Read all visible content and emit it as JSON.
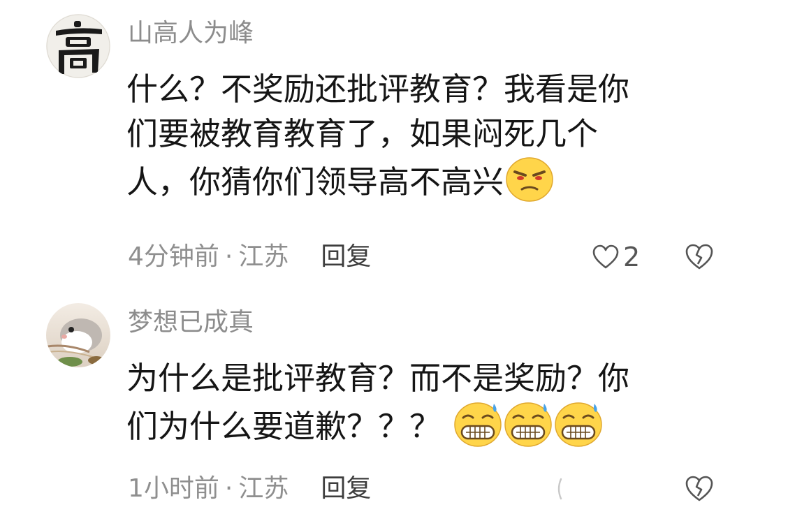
{
  "comments": [
    {
      "username": "山高人为峰",
      "avatar_icon": "calligraphy-avatar-gao",
      "lines": [
        "什么？不奖励还批评教育？我看是你",
        "们要被教育教育了，如果闷死几个",
        "人，你猜你们领导高不高兴"
      ],
      "emoji": "grimace-emoji",
      "time": "4分钟前",
      "separator": "·",
      "location": "江苏",
      "reply_label": "回复",
      "like_count": "2"
    },
    {
      "username": "梦想已成真",
      "avatar_icon": "hamster-photo-avatar",
      "lines": [
        "为什么是批评教育？而不是奖励？你",
        "们为什么要道歉？？？"
      ],
      "emoji": "cold-sweat-grin-emoji",
      "emoji_count": 3,
      "time": "1小时前",
      "separator": "·",
      "location": "江苏",
      "reply_label": "回复"
    }
  ],
  "icons": {
    "like": "heart-outline-icon",
    "dislike": "broken-heart-icon"
  },
  "colors": {
    "username": "#8c8c8c",
    "meta": "#8f8f8f",
    "body": "#151515",
    "emoji_face": "#FFD54A"
  }
}
